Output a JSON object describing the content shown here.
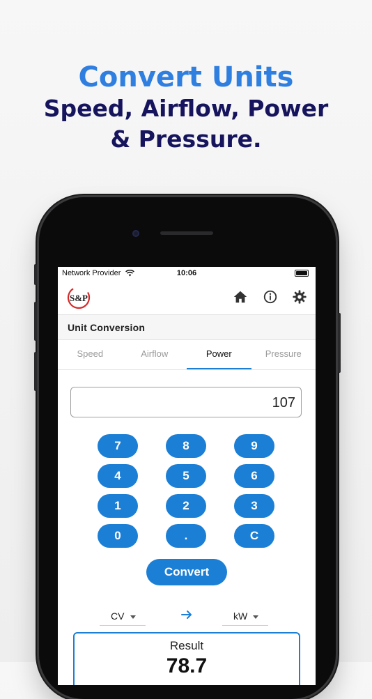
{
  "headline": {
    "line1": "Convert Units",
    "line2": "Speed, Airflow, Power",
    "line3": "& Pressure."
  },
  "status_bar": {
    "carrier": "Network Provider",
    "time": "10:06"
  },
  "app": {
    "logo_text": "S&P",
    "section_title": "Unit Conversion"
  },
  "tabs": [
    {
      "label": "Speed"
    },
    {
      "label": "Airflow"
    },
    {
      "label": "Power"
    },
    {
      "label": "Pressure"
    }
  ],
  "active_tab": "Power",
  "display_value": "107",
  "keys": [
    "7",
    "8",
    "9",
    "4",
    "5",
    "6",
    "1",
    "2",
    "3",
    "0",
    ".",
    "C"
  ],
  "convert_label": "Convert",
  "from_unit": "CV",
  "to_unit": "kW",
  "result": {
    "label": "Result",
    "value": "78.7"
  },
  "colors": {
    "accent_blue": "#1b7fd6",
    "headline_blue": "#2f7fe0",
    "headline_navy": "#15145c"
  },
  "icons": [
    "wifi-icon",
    "battery-icon",
    "home-icon",
    "info-icon",
    "gear-icon",
    "caret-down-icon",
    "arrow-right-icon"
  ]
}
